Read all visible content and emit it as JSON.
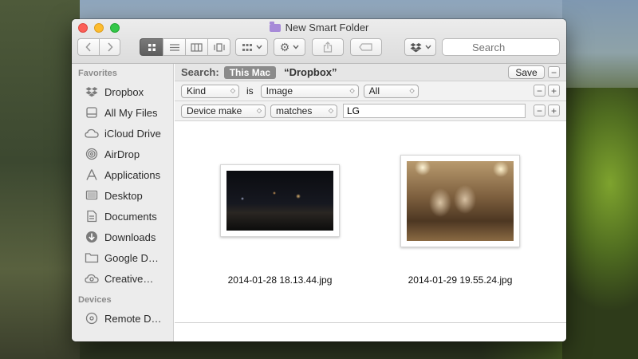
{
  "window": {
    "title": "New Smart Folder",
    "title_icon": "smart-folder-icon"
  },
  "toolbar": {
    "back_icon": "chevron-left-icon",
    "forward_icon": "chevron-right-icon",
    "view_modes": [
      "icon-view",
      "list-view",
      "column-view",
      "cover-flow-view"
    ],
    "active_view": "icon-view",
    "arrange_icon": "arrange-grid-icon",
    "action_icon": "gear-icon",
    "share_icon": "share-icon",
    "tag_icon": "tag-icon",
    "dropbox_icon": "dropbox-icon",
    "search_placeholder": "Search",
    "search_clear_glyph": "✕"
  },
  "sidebar": {
    "favorites_header": "Favorites",
    "favorites": [
      {
        "label": "Dropbox",
        "icon": "dropbox-icon"
      },
      {
        "label": "All My Files",
        "icon": "all-files-icon"
      },
      {
        "label": "iCloud Drive",
        "icon": "cloud-icon"
      },
      {
        "label": "AirDrop",
        "icon": "airdrop-icon"
      },
      {
        "label": "Applications",
        "icon": "applications-icon"
      },
      {
        "label": "Desktop",
        "icon": "desktop-icon"
      },
      {
        "label": "Documents",
        "icon": "documents-icon"
      },
      {
        "label": "Downloads",
        "icon": "downloads-icon"
      },
      {
        "label": "Google D…",
        "icon": "folder-icon"
      },
      {
        "label": "Creative…",
        "icon": "creative-cloud-icon"
      }
    ],
    "devices_header": "Devices",
    "devices": [
      {
        "label": "Remote D…",
        "icon": "disc-icon"
      }
    ]
  },
  "scope": {
    "label": "Search:",
    "selected": "This Mac",
    "other": "“Dropbox”",
    "save_label": "Save",
    "minus": "−"
  },
  "rules": [
    {
      "attribute": "Kind",
      "operator": "is",
      "value": "Image",
      "qualifier": "All",
      "minus": "−",
      "plus": "+"
    },
    {
      "attribute": "Device make",
      "operator": "matches",
      "value": "LG",
      "minus": "−",
      "plus": "+"
    }
  ],
  "results": [
    {
      "name": "2014-01-28 18.13.44.jpg"
    },
    {
      "name": "2014-01-29 19.55.24.jpg"
    }
  ]
}
